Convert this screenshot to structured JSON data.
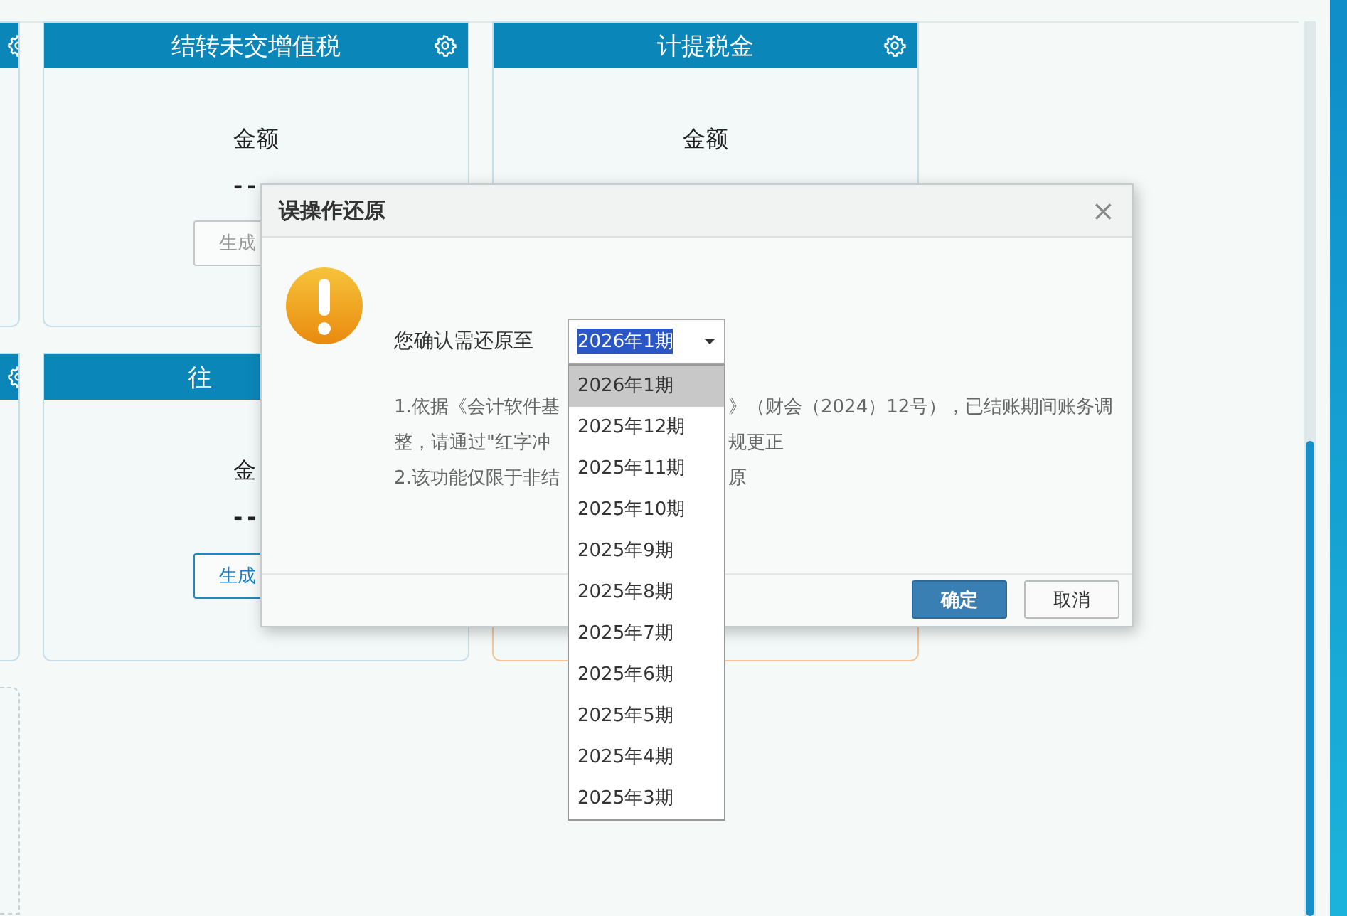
{
  "cards": [
    {
      "kind": "edge"
    },
    {
      "kind": "full",
      "title": "结转未交增值税",
      "label": "金额",
      "value": "--",
      "button": {
        "kind": "plain",
        "label": "生成"
      }
    },
    {
      "kind": "full",
      "title": "计提税金",
      "label": "金额"
    },
    {
      "kind": "edge"
    },
    {
      "kind": "cut",
      "title": "往",
      "label": "金",
      "value": "--",
      "button": {
        "kind": "primary",
        "label": "生成"
      }
    },
    {
      "kind": "accent"
    },
    {
      "kind": "dashed"
    }
  ],
  "dialog": {
    "title": "误操作还原",
    "close": "×",
    "prompt": "您确认需还原至",
    "select": {
      "value": "2026年1期",
      "expanded": true,
      "options": [
        {
          "label": "2026年1期",
          "selected": true
        },
        {
          "label": "2025年12期",
          "selected": false
        },
        {
          "label": "2025年11期",
          "selected": false
        },
        {
          "label": "2025年10期",
          "selected": false
        },
        {
          "label": "2025年9期",
          "selected": false
        },
        {
          "label": "2025年8期",
          "selected": false
        },
        {
          "label": "2025年7期",
          "selected": false
        },
        {
          "label": "2025年6期",
          "selected": false
        },
        {
          "label": "2025年5期",
          "selected": false
        },
        {
          "label": "2025年4期",
          "selected": false
        },
        {
          "label": "2025年3期",
          "selected": false
        }
      ]
    },
    "notes": [
      {
        "left": "1.依据《会计软件基",
        "right": "》（财会（2024）12号），已结账期间账务调"
      },
      {
        "left": "整，请通过\"红字冲",
        "right": "规更正"
      },
      {
        "left": "2.该功能仅限于非结",
        "right": "原"
      }
    ],
    "buttons": [
      {
        "kind": "primary",
        "label": "确定"
      },
      {
        "kind": "plain",
        "label": "取消"
      }
    ]
  }
}
